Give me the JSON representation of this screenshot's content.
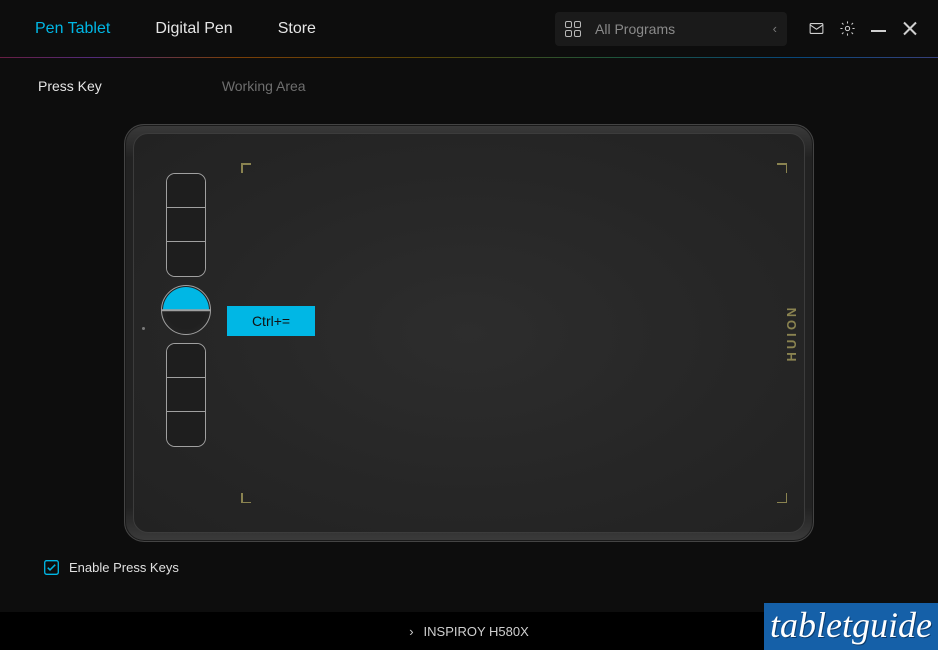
{
  "nav": {
    "tabs": [
      {
        "label": "Pen Tablet",
        "active": true
      },
      {
        "label": "Digital Pen",
        "active": false
      },
      {
        "label": "Store",
        "active": false
      }
    ]
  },
  "program_selector": {
    "label": "All Programs"
  },
  "subtabs": {
    "press_key": "Press Key",
    "working_area": "Working Area"
  },
  "tablet": {
    "brand": "HUION",
    "tooltip": "Ctrl+="
  },
  "enable_press_keys_label": "Enable Press Keys",
  "device_name": "INSPIROY H580X",
  "watermark": "tabletguide"
}
